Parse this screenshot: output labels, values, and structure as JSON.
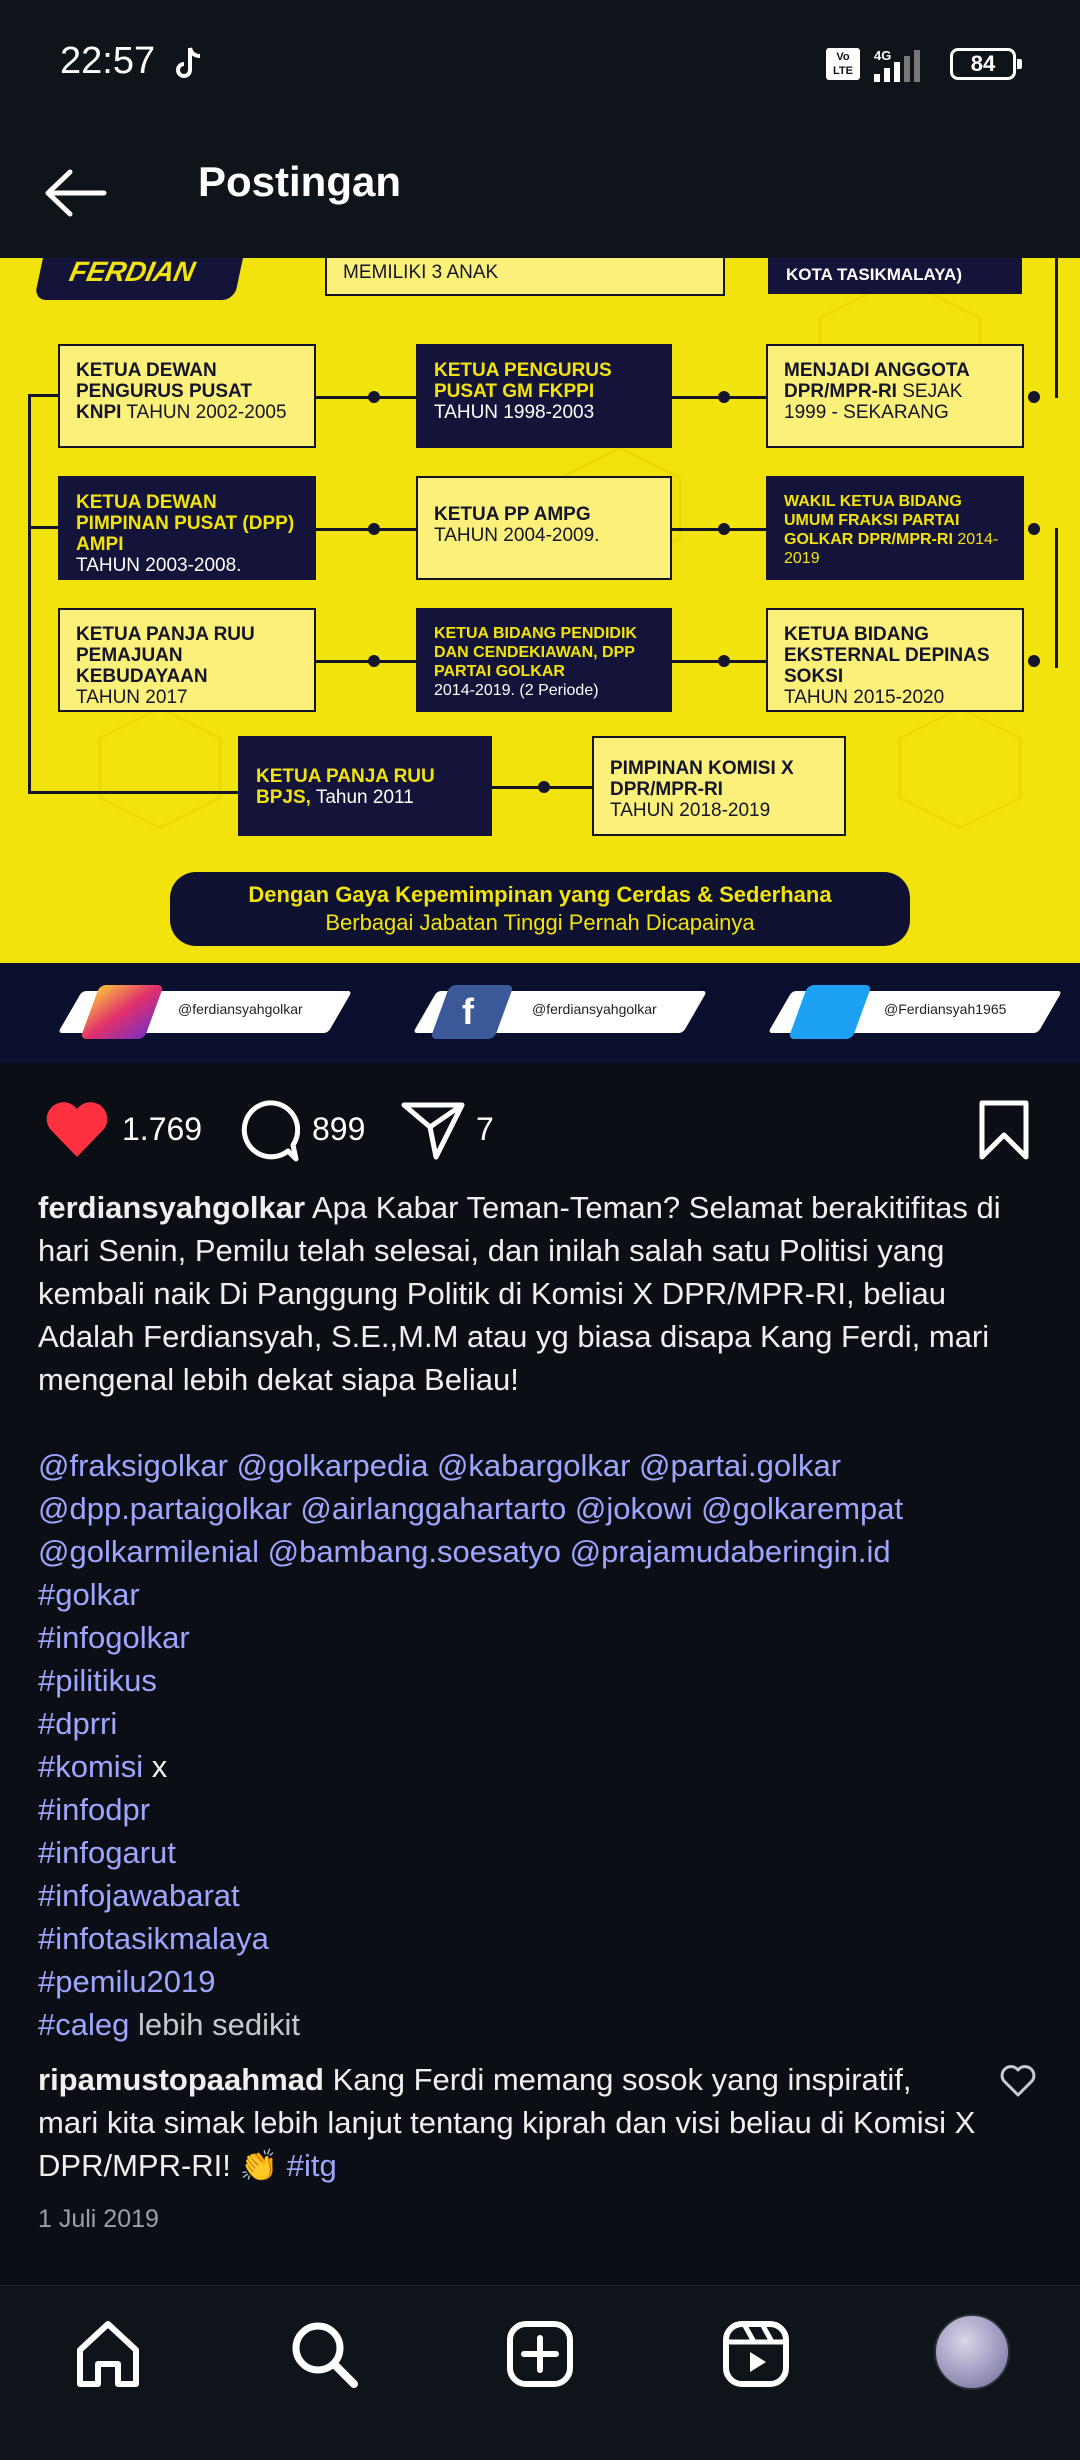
{
  "status_bar": {
    "time": "22:57",
    "network": "4G",
    "volte": "Vo LTE",
    "battery": "84"
  },
  "header": {
    "title": "Postingan"
  },
  "post_image": {
    "brand_top": "FERDIAN",
    "top_middle": [
      "MEMILIKI 3 ANAK"
    ],
    "top_right": [
      "KOTA TASIKMALAYA)"
    ],
    "cards": {
      "r1c1": {
        "bold": "KETUA DEWAN PENGURUS PUSAT KNPI",
        "plain": " TAHUN 2002-2005"
      },
      "r1c2": {
        "bold": "KETUA PENGURUS PUSAT GM FKPPI",
        "plain": "TAHUN 1998-2003"
      },
      "r1c3": {
        "bold": "MENJADI ANGGOTA DPR/MPR-RI",
        "plain": " SEJAK 1999 - SEKARANG"
      },
      "r2c1": {
        "bold": "KETUA DEWAN PIMPINAN PUSAT (DPP) AMPI",
        "plain": "TAHUN 2003-2008."
      },
      "r2c2": {
        "bold": "KETUA PP AMPG",
        "plain": "TAHUN 2004-2009."
      },
      "r2c3": {
        "bold": "WAKIL KETUA BIDANG UMUM FRAKSI PARTAI GOLKAR DPR/MPR-RI",
        "plain": " 2014-2019"
      },
      "r3c1": {
        "bold": "KETUA PANJA RUU PEMAJUAN KEBUDAYAAN",
        "plain": "TAHUN 2017"
      },
      "r3c2": {
        "bold": "KETUA BIDANG PENDIDIK DAN CENDEKIAWAN, DPP PARTAI GOLKAR",
        "plain": "2014-2019. (2 Periode)"
      },
      "r3c3": {
        "bold": "KETUA BIDANG EKSTERNAL DEPINAS SOKSI",
        "plain": "TAHUN 2015-2020"
      },
      "r4c1": {
        "bold": "KETUA PANJA RUU BPJS,",
        "plain": " Tahun 2011"
      },
      "r4c2": {
        "bold": "PIMPINAN KOMISI X DPR/MPR-RI",
        "plain": "TAHUN 2018-2019"
      }
    },
    "banner_line1": "Dengan Gaya Kepemimpinan yang Cerdas & Sederhana",
    "banner_line2": "Berbagai Jabatan Tinggi Pernah Dicapainya",
    "socials": {
      "instagram": "@ferdiansyahgolkar",
      "facebook": "@ferdiansyahgolkar",
      "twitter": "@Ferdiansyah1965"
    }
  },
  "actions": {
    "likes": "1.769",
    "comments": "899",
    "shares": "7"
  },
  "caption": {
    "username": "ferdiansyahgolkar",
    "text": " Apa Kabar Teman-Teman? Selamat berakitifitas di hari Senin, Pemilu telah selesai, dan inilah salah satu Politisi yang kembali naik Di Panggung Politik di Komisi X DPR/MPR-RI, beliau Adalah Ferdiansyah, S.E.,M.M atau yg biasa disapa Kang Ferdi, mari mengenal lebih dekat siapa Beliau!",
    "mentions_line1": "@fraksigolkar @golkarpedia @kabargolkar @partai.golkar",
    "mentions_line2": "@dpp.partaigolkar @airlanggahartarto @jokowi @golkarempat",
    "mentions_line3": "@golkarmilenial @bambang.soesatyo @prajamudaberingin.id",
    "hashtags": [
      "#golkar",
      "#infogolkar",
      "#pilitikus",
      "#dprri",
      "#komisi",
      "#infodpr",
      "#infogarut",
      "#infojawabarat",
      "#infotasikmalaya",
      "#pemilu2019",
      "#caleg"
    ],
    "komisi_suffix": " x",
    "more": " lebih sedikit"
  },
  "comment": {
    "username": "ripamustopaahmad",
    "text": " Kang Ferdi memang sosok yang inspiratif, mari kita simak lebih lanjut tentang kiprah dan visi beliau di Komisi X DPR/MPR-RI! 👏 ",
    "tag": "#itg"
  },
  "post_date": "1 Juli 2019",
  "bottom_nav": [
    "home-icon",
    "search-icon",
    "add-post-icon",
    "reels-icon",
    "profile-avatar"
  ],
  "colors": {
    "accent_yellow": "#f3e30c",
    "navy": "#14143a",
    "like_red": "#ff3040",
    "link": "#9ea6ff"
  }
}
